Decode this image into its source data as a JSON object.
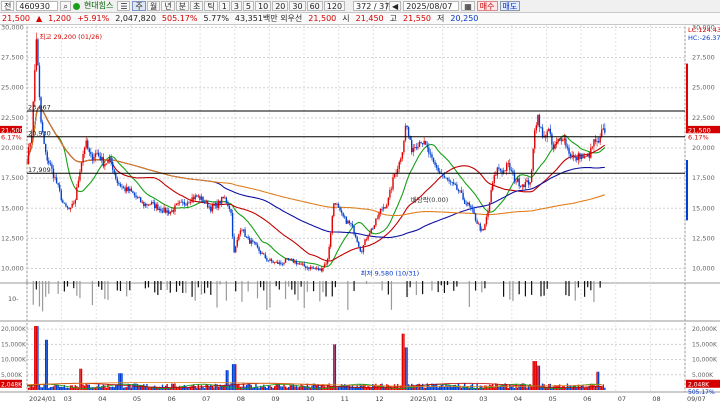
{
  "toolbar": {
    "market": "전",
    "code": "460930",
    "name": "현대힘스",
    "period_buttons": [
      "주",
      "월",
      "년",
      "분",
      "초",
      "틱",
      "1",
      "3",
      "5",
      "10",
      "20",
      "30",
      "60",
      "120"
    ],
    "active_period": "주",
    "page_counter": "372 / 372",
    "date": "2025/08/07",
    "buy_label": "매수",
    "sell_label": "매도"
  },
  "quote": {
    "price": "21,500",
    "change_arrow": "▲",
    "change": "1,200",
    "change_pct": "+5.91%",
    "volume": "2,047,820",
    "turnover_pct": "505.17%",
    "ratio": "5.77%",
    "amount": "43,351백만",
    "amount_suffix": "외우선",
    "open_label": "시",
    "open": "21,500",
    "high_value_prefix": "",
    "high_value": "21,450",
    "high_label": "고",
    "high": "21,550",
    "low_label": "저",
    "low": "20,250"
  },
  "colors": {
    "up": "#e00000",
    "down": "#0040d0",
    "ma5": "#18a018",
    "ma20": "#c00000",
    "ma60": "#1010a0",
    "ma120": "#e08020",
    "axis_line": "#cfcfcf",
    "level_line": "#000000"
  },
  "chart_data": [
    {
      "type": "candlestick",
      "title": "",
      "x_ticks": [
        "2024/01",
        "03",
        "04",
        "05",
        "06",
        "07",
        "08",
        "09",
        "10",
        "11",
        "12",
        "2025/01",
        "02",
        "03",
        "04",
        "05",
        "06",
        "07",
        "08",
        "09/07"
      ],
      "y_ticks": [
        30000,
        27500,
        25000,
        22500,
        20000,
        17500,
        15000,
        12500,
        10000
      ],
      "y_tick_labels": [
        "30,000",
        "27,500",
        "25,000",
        "22,500",
        "20,000",
        "17,500",
        "15,000",
        "12,500",
        "10,000"
      ],
      "ylim": [
        8800,
        30200
      ],
      "levels": [
        {
          "value": 23067,
          "label": "23,067"
        },
        {
          "value": 20930,
          "label": "20,930"
        },
        {
          "value": 17900,
          "label": "17,909"
        }
      ],
      "right_labels": [
        {
          "value": 21500,
          "label": "21,500",
          "color": "#d40000"
        },
        {
          "value": 20890,
          "label": "6.17%",
          "color": "#d40000"
        }
      ],
      "top_right_labels": [
        "LC:124.43",
        "HC:-26.37"
      ],
      "left_labels": [
        {
          "value": 21500,
          "label": "21,500"
        },
        {
          "value": 20900,
          "label": "6.17%"
        }
      ],
      "annotations": [
        {
          "text": "최고 29,200 (01/26)",
          "month_pos": 0.28,
          "value": 29200
        },
        {
          "text": "최저 9,580 (10/31)",
          "month_pos": 9.9,
          "value": 9580
        },
        {
          "text": "배당락(0.00)",
          "month_pos": 11.4,
          "value": 15700
        }
      ],
      "close_path": [
        [
          0.0,
          19000
        ],
        [
          0.15,
          21500
        ],
        [
          0.28,
          29200
        ],
        [
          0.4,
          22500
        ],
        [
          0.55,
          19500
        ],
        [
          0.7,
          18500
        ],
        [
          0.9,
          17000
        ],
        [
          1.1,
          15200
        ],
        [
          1.3,
          14800
        ],
        [
          1.45,
          15800
        ],
        [
          1.6,
          18500
        ],
        [
          1.75,
          20500
        ],
        [
          1.9,
          19200
        ],
        [
          2.1,
          19600
        ],
        [
          2.3,
          18700
        ],
        [
          2.5,
          19000
        ],
        [
          2.7,
          17200
        ],
        [
          2.9,
          16600
        ],
        [
          3.1,
          16400
        ],
        [
          3.3,
          15800
        ],
        [
          3.5,
          15300
        ],
        [
          3.7,
          15400
        ],
        [
          3.9,
          15100
        ],
        [
          4.1,
          14800
        ],
        [
          4.3,
          14700
        ],
        [
          4.5,
          15200
        ],
        [
          4.7,
          15400
        ],
        [
          4.9,
          15800
        ],
        [
          5.1,
          16000
        ],
        [
          5.3,
          15600
        ],
        [
          5.5,
          15000
        ],
        [
          5.7,
          15300
        ],
        [
          5.9,
          15900
        ],
        [
          6.1,
          14900
        ],
        [
          6.2,
          11200
        ],
        [
          6.4,
          13500
        ],
        [
          6.6,
          12400
        ],
        [
          6.8,
          12000
        ],
        [
          7.0,
          11300
        ],
        [
          7.2,
          10700
        ],
        [
          7.4,
          10500
        ],
        [
          7.6,
          10400
        ],
        [
          7.8,
          10700
        ],
        [
          8.0,
          10600
        ],
        [
          8.2,
          10300
        ],
        [
          8.4,
          10100
        ],
        [
          8.6,
          10000
        ],
        [
          8.8,
          9900
        ],
        [
          9.0,
          10700
        ],
        [
          9.2,
          15800
        ],
        [
          9.35,
          14700
        ],
        [
          9.5,
          14100
        ],
        [
          9.7,
          13600
        ],
        [
          9.85,
          12700
        ],
        [
          10.0,
          11400
        ],
        [
          10.2,
          12800
        ],
        [
          10.4,
          13600
        ],
        [
          10.6,
          14900
        ],
        [
          10.8,
          15500
        ],
        [
          11.0,
          17800
        ],
        [
          11.15,
          18800
        ],
        [
          11.25,
          20100
        ],
        [
          11.35,
          22100
        ],
        [
          11.5,
          19900
        ],
        [
          11.65,
          20300
        ],
        [
          11.8,
          20700
        ],
        [
          12.0,
          19800
        ],
        [
          12.15,
          18700
        ],
        [
          12.3,
          18200
        ],
        [
          12.5,
          17500
        ],
        [
          12.7,
          17000
        ],
        [
          12.9,
          16500
        ],
        [
          13.1,
          15600
        ],
        [
          13.3,
          14900
        ],
        [
          13.5,
          13700
        ],
        [
          13.65,
          12900
        ],
        [
          13.8,
          14700
        ],
        [
          13.95,
          17200
        ],
        [
          14.1,
          18400
        ],
        [
          14.25,
          18000
        ],
        [
          14.4,
          18600
        ],
        [
          14.6,
          17400
        ],
        [
          14.8,
          17000
        ],
        [
          15.0,
          17100
        ],
        [
          15.1,
          17500
        ],
        [
          15.2,
          21700
        ],
        [
          15.3,
          22700
        ],
        [
          15.45,
          20600
        ],
        [
          15.6,
          21700
        ],
        [
          15.75,
          19800
        ],
        [
          15.9,
          20600
        ],
        [
          16.05,
          21000
        ],
        [
          16.2,
          19800
        ],
        [
          16.4,
          19000
        ],
        [
          16.55,
          19400
        ],
        [
          16.7,
          19100
        ],
        [
          16.85,
          19500
        ],
        [
          17.0,
          20700
        ],
        [
          17.1,
          20100
        ],
        [
          17.2,
          21200
        ],
        [
          17.3,
          21500
        ]
      ],
      "ma_series": [
        {
          "key": "ma5",
          "window": 4
        },
        {
          "key": "ma20",
          "window": 10
        },
        {
          "key": "ma60",
          "window": 24
        },
        {
          "key": "ma120",
          "window": 44
        }
      ]
    },
    {
      "type": "bar",
      "title": "",
      "y_tick_labels": [
        "10-"
      ]
    },
    {
      "type": "bar",
      "title": "",
      "y_ticks": [
        20000,
        15000,
        10000,
        5000
      ],
      "y_tick_labels": [
        "20,000K",
        "15,000K",
        "10,000K",
        "5,000K"
      ],
      "right_tick_labels": [
        "20,000K",
        "15,000K",
        "10,000K",
        "5,000K"
      ],
      "ylim": [
        0,
        22000
      ],
      "current_label": "2,048K",
      "current_pct": "505.17%",
      "spike_month_pos": [
        0.28,
        0.6,
        1.6,
        2.8,
        6.0,
        6.2,
        9.2,
        11.25,
        11.35,
        15.2,
        15.3,
        17.1
      ],
      "spike_values": [
        21000,
        16500,
        7000,
        5500,
        6500,
        8500,
        15000,
        18500,
        14000,
        9500,
        8000,
        6000
      ]
    }
  ]
}
